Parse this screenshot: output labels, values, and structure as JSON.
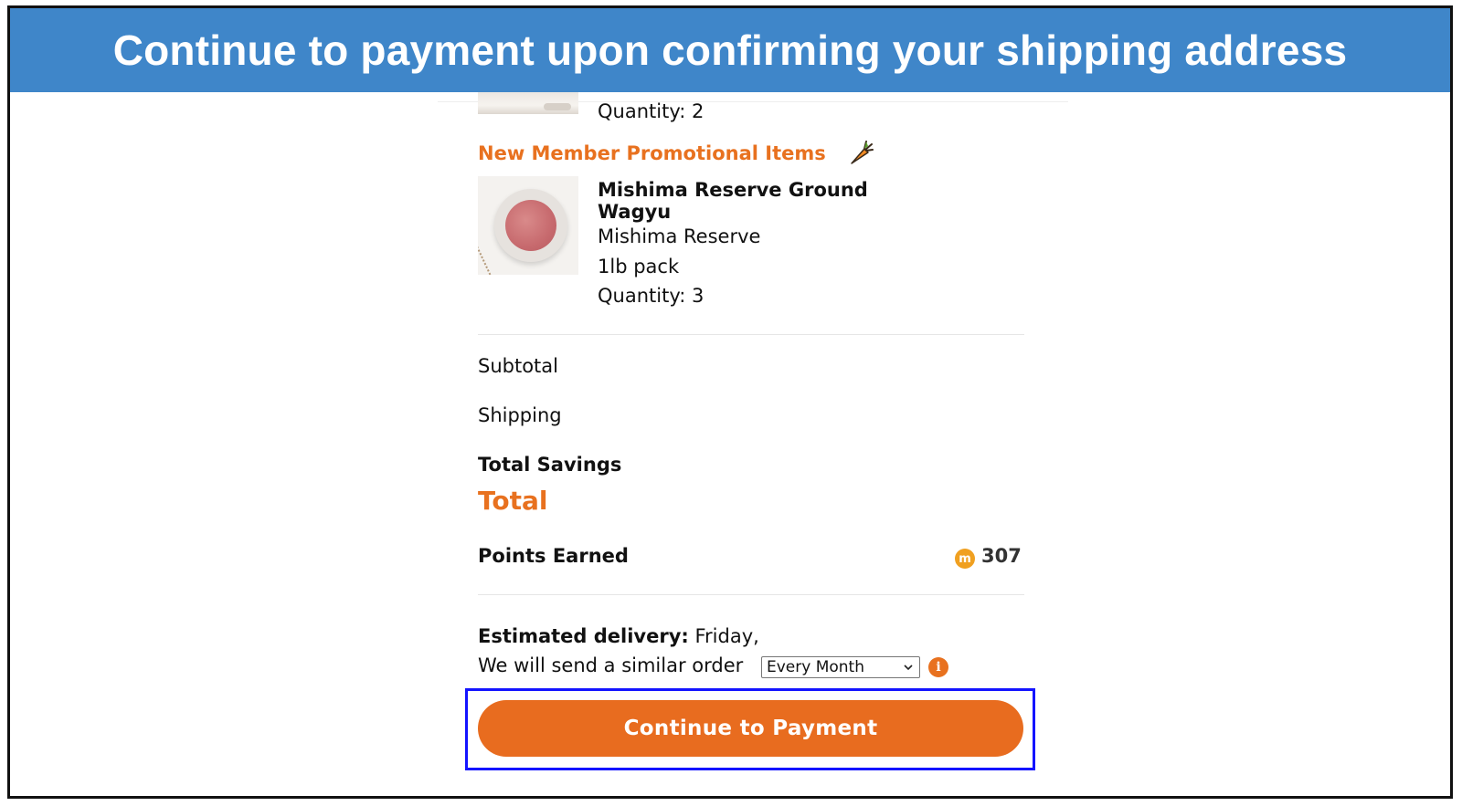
{
  "banner": {
    "title": "Continue to payment upon confirming your shipping address"
  },
  "previous_item": {
    "quantity": "Quantity: 2"
  },
  "promo_section": {
    "title": "New Member Promotional Items",
    "icon": "carrot-icon",
    "item": {
      "name": "Mishima Reserve Ground Wagyu",
      "brand": "Mishima Reserve",
      "size": "1lb pack",
      "quantity": "Quantity: 3"
    }
  },
  "summary": {
    "subtotal_label": "Subtotal",
    "shipping_label": "Shipping",
    "savings_label": "Total Savings",
    "total_label": "Total",
    "points_label": "Points Earned",
    "points_icon_letter": "m",
    "points_value": "307"
  },
  "delivery": {
    "estimated_label": "Estimated delivery:",
    "estimated_value": "Friday,",
    "recurring_text": "We will send a similar order",
    "frequency_selected": "Every Month"
  },
  "checkout": {
    "continue_label": "Continue to Payment"
  },
  "colors": {
    "accent": "#e8711f",
    "banner": "#3f86c9",
    "highlight": "#1414ff"
  }
}
